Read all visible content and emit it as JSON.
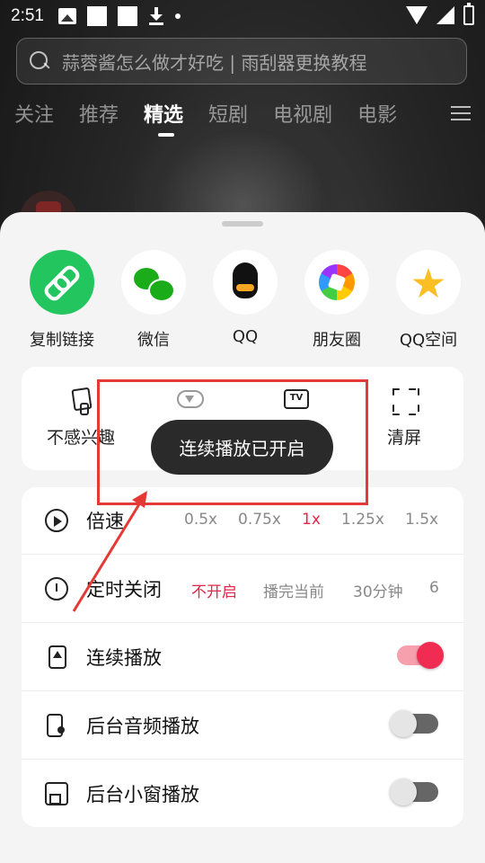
{
  "status_bar": {
    "time": "2:51"
  },
  "search": {
    "placeholder": "蒜蓉酱怎么做才好吃 | 雨刮器更换教程"
  },
  "top_tabs": [
    {
      "label": "关注"
    },
    {
      "label": "推荐"
    },
    {
      "label": "精选",
      "active": true
    },
    {
      "label": "短剧"
    },
    {
      "label": "电视剧"
    },
    {
      "label": "电影"
    }
  ],
  "share_targets": [
    {
      "label": "复制链接",
      "icon": "link-icon"
    },
    {
      "label": "微信",
      "icon": "wechat-icon"
    },
    {
      "label": "QQ",
      "icon": "qq-icon"
    },
    {
      "label": "朋友圈",
      "icon": "moments-icon"
    },
    {
      "label": "QQ空间",
      "icon": "qzone-icon"
    }
  ],
  "actions": [
    {
      "label": "不感兴趣",
      "icon": "thumbs-down-icon"
    },
    {
      "label": "下载",
      "icon": "cloud-download-icon"
    },
    {
      "label": "投屏",
      "icon": "tv-cast-icon"
    },
    {
      "label": "清屏",
      "icon": "fullscreen-frame-icon"
    }
  ],
  "settings": {
    "speed": {
      "label": "倍速",
      "options": [
        "0.5x",
        "0.75x",
        "1x",
        "1.25x",
        "1.5x"
      ],
      "selected": "1x"
    },
    "timer": {
      "label": "定时关闭",
      "options": [
        "不开启",
        "播完当前",
        "30分钟",
        "6"
      ],
      "selected": "不开启"
    },
    "continuous": {
      "label": "连续播放",
      "on": true
    },
    "bg_audio": {
      "label": "后台音频播放",
      "on": false
    },
    "bg_pip": {
      "label": "后台小窗播放",
      "on": false
    }
  },
  "toast": {
    "text": "连续播放已开启"
  },
  "colors": {
    "accent": "#e2274a",
    "toggle_on": "#f02c53",
    "annotation": "#e53935",
    "link_green": "#22c55e"
  }
}
